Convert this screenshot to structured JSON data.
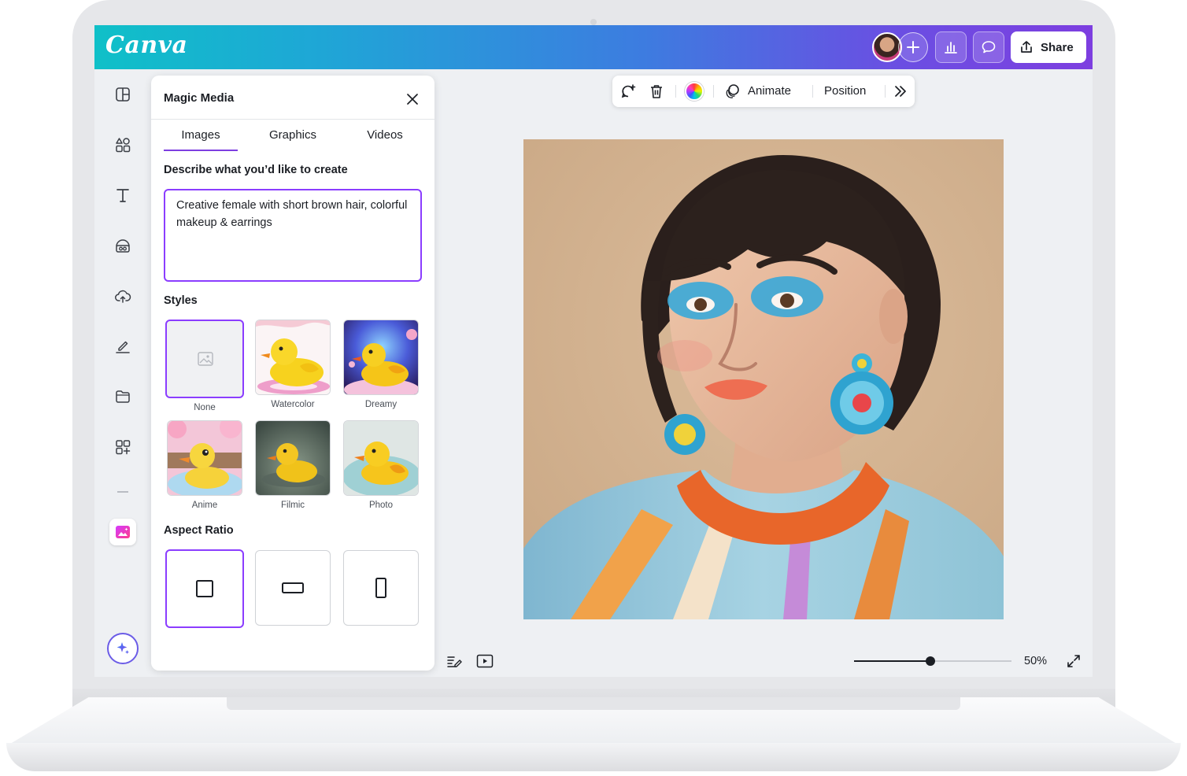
{
  "app": {
    "logo": "Canva"
  },
  "header": {
    "share_label": "Share"
  },
  "panel": {
    "title": "Magic Media",
    "tabs": [
      {
        "label": "Images",
        "active": true
      },
      {
        "label": "Graphics",
        "active": false
      },
      {
        "label": "Videos",
        "active": false
      }
    ],
    "prompt_label": "Describe what you’d like to create",
    "prompt_value": "Creative female with short brown hair, colorful makeup & earrings",
    "styles_label": "Styles",
    "styles": [
      {
        "label": "None",
        "selected": true
      },
      {
        "label": "Watercolor",
        "selected": false
      },
      {
        "label": "Dreamy",
        "selected": false
      },
      {
        "label": "Anime",
        "selected": false
      },
      {
        "label": "Filmic",
        "selected": false
      },
      {
        "label": "Photo",
        "selected": false
      }
    ],
    "aspect_label": "Aspect Ratio",
    "aspect_ratios": [
      {
        "shape": "square",
        "selected": true
      },
      {
        "shape": "landscape",
        "selected": false
      },
      {
        "shape": "portrait",
        "selected": false
      }
    ]
  },
  "toolbar": {
    "animate_label": "Animate",
    "position_label": "Position"
  },
  "footer": {
    "zoom_label": "50%",
    "zoom_fraction": 0.5
  },
  "colors": {
    "accent": "#8b3dff",
    "header_start": "#0fc0c8",
    "header_end": "#7d3ee0"
  },
  "icons": {
    "rail": [
      "design-icon",
      "elements-icon",
      "text-icon",
      "brand-icon",
      "uploads-icon",
      "draw-icon",
      "projects-icon",
      "apps-icon",
      "magic-media-icon",
      "magic-sparkle-icon"
    ],
    "header": [
      "avatar",
      "plus-icon",
      "insights-icon",
      "comment-icon",
      "share-upload-icon"
    ],
    "toolbar": [
      "regenerate-icon",
      "trash-icon",
      "color-wheel-icon",
      "animate-icon",
      "more-chevrons-icon"
    ],
    "footer": [
      "notes-icon",
      "present-icon",
      "fullscreen-icon"
    ]
  }
}
